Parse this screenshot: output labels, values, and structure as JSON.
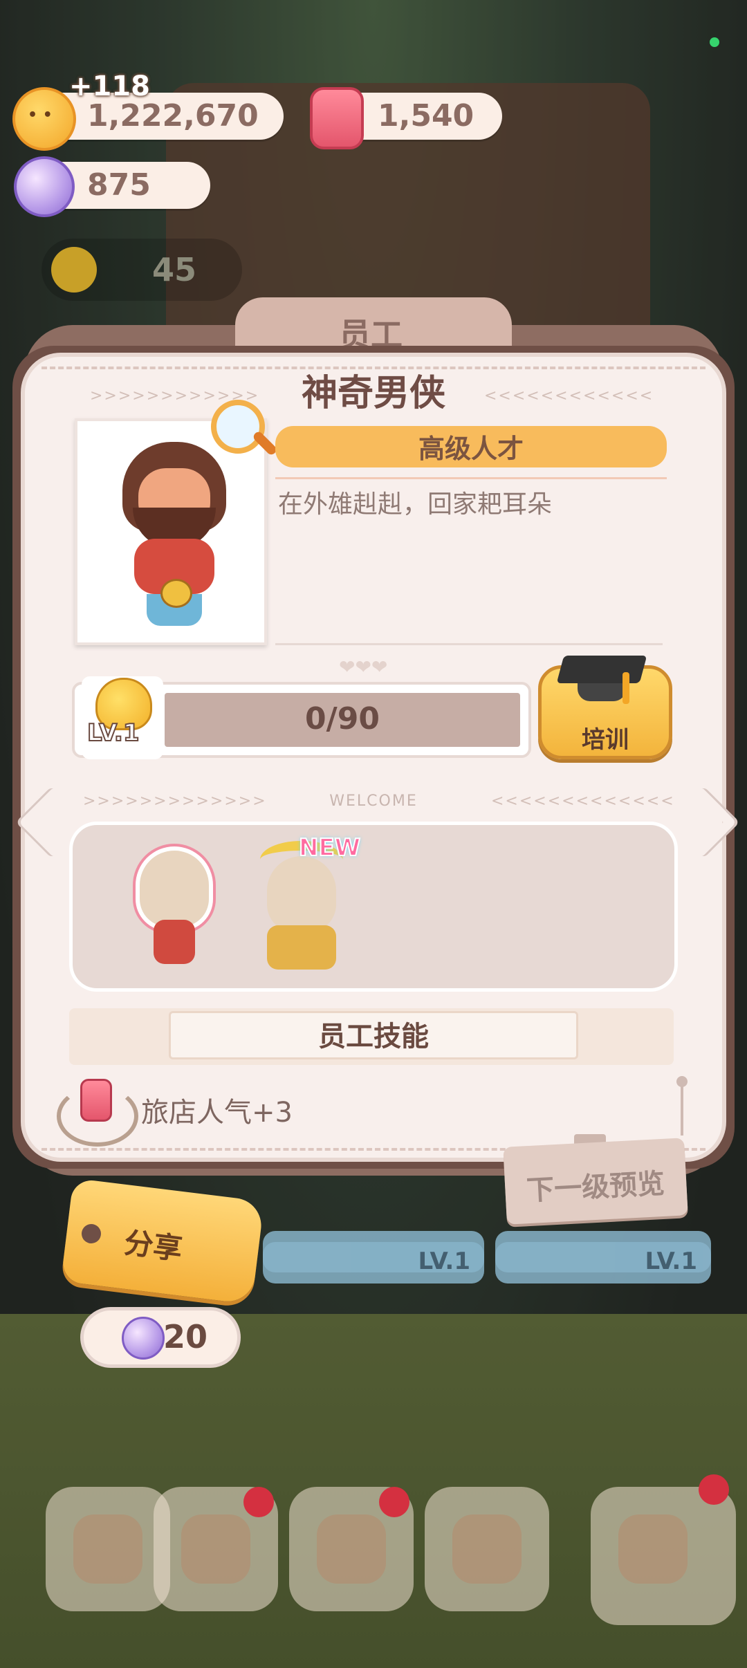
{
  "resources": {
    "coins": {
      "value": "1,222,670",
      "gain": "+118",
      "icon": "coin-icon"
    },
    "candles": {
      "value": "1,540",
      "icon": "candle-icon"
    },
    "gems": {
      "value": "875",
      "icon": "gem-icon"
    },
    "faded_counter": "45"
  },
  "panel": {
    "tab_title": "员工",
    "character_name": "神奇男侠",
    "rank": "高级人才",
    "motto": "在外雄赳赳，回家耙耳朵",
    "level_label": "LV.1",
    "xp_text": "0/90",
    "train_label": "培训",
    "welcome_label": "WELCOME",
    "new_badge": "NEW",
    "skills_title": "员工技能",
    "skill": "旅店人气+3",
    "next_preview_label": "下一级预览"
  },
  "share": {
    "label": "分享",
    "cost": "20"
  },
  "under_panel": {
    "row_labels": [
      "LV.1",
      "LV.1"
    ]
  },
  "colors": {
    "accent_orange": "#f4b03a",
    "paper": "#f8efec",
    "text_brown": "#6a4a40"
  }
}
